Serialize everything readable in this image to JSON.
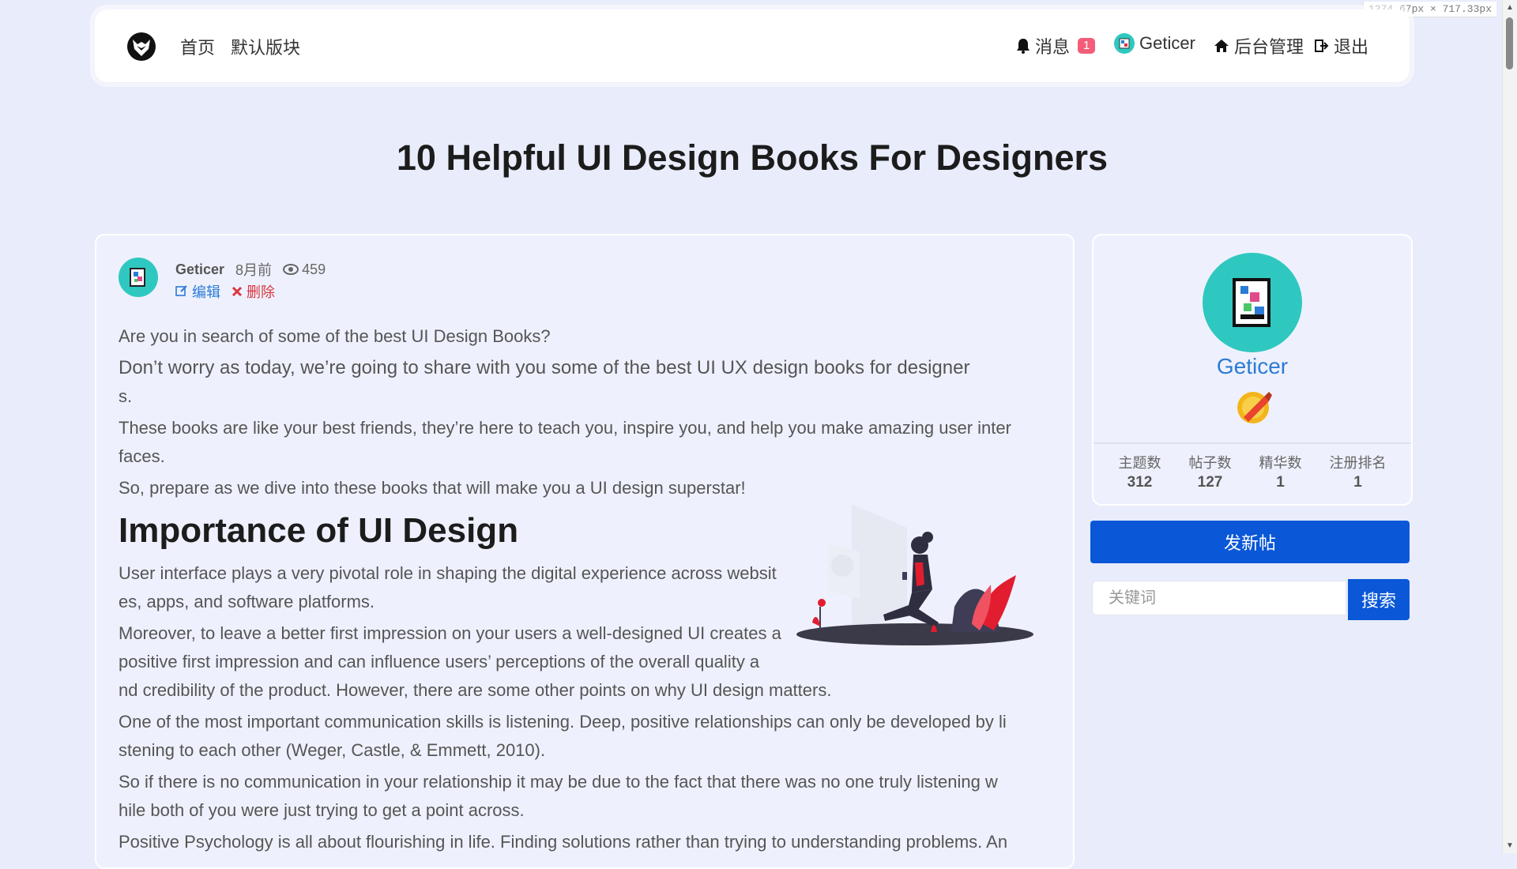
{
  "viewport_readout": "1274.67px × 717.33px",
  "nav": {
    "home": "首页",
    "default_board": "默认版块",
    "messages": "消息",
    "message_count": "1",
    "username": "Geticer",
    "admin": "后台管理",
    "logout": "退出"
  },
  "page_title": "10 Helpful UI Design Books For Designers",
  "post": {
    "author": "Geticer",
    "time": "8月前",
    "views": "459",
    "edit": "编辑",
    "delete": "删除",
    "p1": "Are you in search of some of the best UI Design Books?",
    "p2a": "Don’t worry as today, we’re going to share with you some of the best UI UX design books for designer",
    "p2b": "s.",
    "p3a": "These books are like your best friends, they’re here to teach you, inspire you, and help you make amazing user inter",
    "p3b": "faces.",
    "p4": "So, prepare as we dive into these books that will make you a UI design superstar!",
    "h2": "Importance of UI Design",
    "p5a": "User interface plays a very pivotal role in shaping the digital experience across websit",
    "p5b": "es, apps, and software platforms.",
    "p6a": "Moreover, to leave a better first impression on your users a well-designed UI creates a",
    "p6b": "positive first impression and can influence users’  perceptions of the overall quality a",
    "p6c": "nd credibility of the product. However, there are some other points on why UI design matters.",
    "p7a": "One of the most important communication skills is listening. Deep, positive relationships can only be developed by li",
    "p7b": "stening to each other (Weger, Castle, & Emmett, 2010).",
    "p8a": "So if there is no communication in your relationship it may be due to the fact that there was no one truly listening w",
    "p8b": "hile both of you were just trying to get a point across.",
    "p9": "Positive Psychology is all about flourishing in life. Finding solutions rather than trying to understanding problems. An"
  },
  "sidebar": {
    "name": "Geticer",
    "stats": [
      {
        "label": "主题数",
        "value": "312"
      },
      {
        "label": "帖子数",
        "value": "127"
      },
      {
        "label": "精华数",
        "value": "1"
      },
      {
        "label": "注册排名",
        "value": "1"
      }
    ],
    "new_post": "发新帖",
    "search_placeholder": "关键词",
    "search_button": "搜索"
  },
  "colors": {
    "accent": "#0a57d8",
    "link": "#2b7bd6",
    "badge": "#f35d7a",
    "avatar": "#2fc8c0",
    "background": "#e9ecfb"
  },
  "icons": [
    "site-logo-icon",
    "bell-icon",
    "user-avatar-icon",
    "home-icon",
    "logout-icon",
    "eye-icon",
    "edit-icon",
    "close-icon",
    "medal-icon"
  ]
}
